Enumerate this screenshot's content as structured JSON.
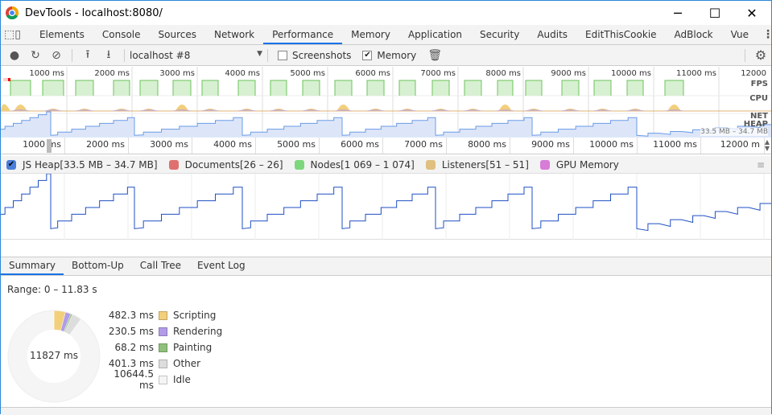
{
  "window": {
    "title": "DevTools - localhost:8080/",
    "minimize": "─",
    "maximize": "☐",
    "close": "✕"
  },
  "tabs": [
    {
      "label": "Elements"
    },
    {
      "label": "Console"
    },
    {
      "label": "Sources"
    },
    {
      "label": "Network"
    },
    {
      "label": "Performance",
      "active": true
    },
    {
      "label": "Memory"
    },
    {
      "label": "Application"
    },
    {
      "label": "Security"
    },
    {
      "label": "Audits"
    },
    {
      "label": "EditThisCookie"
    },
    {
      "label": "AdBlock"
    },
    {
      "label": "Vue"
    }
  ],
  "toolbar": {
    "recording": "localhost #8",
    "screenshots_label": "Screenshots",
    "screenshots_checked": false,
    "memory_label": "Memory",
    "memory_checked": true
  },
  "overview": {
    "ticks": [
      "1000 ms",
      "2000 ms",
      "3000 ms",
      "4000 ms",
      "5000 ms",
      "6000 ms",
      "7000 ms",
      "8000 ms",
      "9000 ms",
      "10000 ms",
      "11000 ms",
      "12000"
    ],
    "labels": {
      "fps": "FPS",
      "cpu": "CPU",
      "net": "NET",
      "heap": "HEAP"
    },
    "heap_range": "33.5 MB – 34.7 MB"
  },
  "ruler": {
    "ticks": [
      "1000 ms",
      "2000 ms",
      "3000 ms",
      "4000 ms",
      "5000 ms",
      "6000 ms",
      "7000 ms",
      "8000 ms",
      "9000 ms",
      "10000 ms",
      "11000 ms",
      "12000 m"
    ]
  },
  "memory_legend": [
    {
      "label": "JS Heap[33.5 MB – 34.7 MB]",
      "color": "#4a7fd9",
      "checked": true
    },
    {
      "label": "Documents[26 – 26]",
      "color": "#e07070"
    },
    {
      "label": "Nodes[1 069 – 1 074]",
      "color": "#7cd77c"
    },
    {
      "label": "Listeners[51 – 51]",
      "color": "#e0c080"
    },
    {
      "label": "GPU Memory",
      "color": "#d77cd7"
    }
  ],
  "lower_tabs": [
    {
      "label": "Summary",
      "active": true
    },
    {
      "label": "Bottom-Up"
    },
    {
      "label": "Call Tree"
    },
    {
      "label": "Event Log"
    }
  ],
  "summary": {
    "range": "Range: 0 – 11.83 s",
    "total": "11827 ms",
    "items": [
      {
        "value": "482.3 ms",
        "label": "Scripting",
        "color": "#f2cf7b",
        "ms": 482.3
      },
      {
        "value": "230.5 ms",
        "label": "Rendering",
        "color": "#b29be8",
        "ms": 230.5
      },
      {
        "value": "68.2 ms",
        "label": "Painting",
        "color": "#8ec07c",
        "ms": 68.2
      },
      {
        "value": "401.3 ms",
        "label": "Other",
        "color": "#dddddd",
        "ms": 401.3
      },
      {
        "value": "10644.5 ms",
        "label": "Idle",
        "color": "#f5f5f5",
        "ms": 10644.5
      }
    ]
  }
}
